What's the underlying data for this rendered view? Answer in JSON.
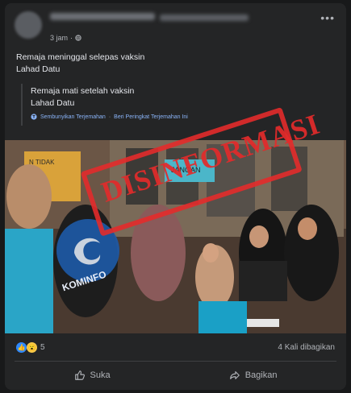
{
  "post": {
    "time": "3 jam",
    "text": "Remaja meninggal selepas vaksin\nLahad Datu",
    "more_label": "•••"
  },
  "translation": {
    "text": "Remaja mati setelah vaksin\nLahad Datu",
    "hide_link": "Sembunyikan Terjemahan",
    "rate_link": "Beri Peringkat Terjemahan Ini"
  },
  "image": {
    "stamp_text": "DISINFORMASI",
    "logo_text": "KOMINFO",
    "sign_text": "JANGAN",
    "left_sign_text": "N TIDAK"
  },
  "footer": {
    "reaction_count": "5",
    "share_count": "4 Kali dibagikan",
    "like_label": "Suka",
    "share_label": "Bagikan"
  },
  "colors": {
    "background": "#18191a",
    "card": "#242526",
    "stamp": "#e32b2b",
    "link": "#8ab4f8"
  }
}
